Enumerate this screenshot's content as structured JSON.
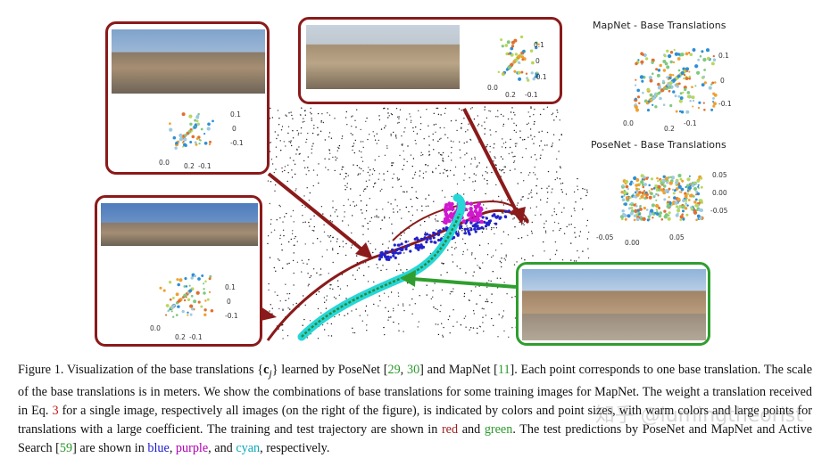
{
  "plots": {
    "mapnet_title": "MapNet - Base Translations",
    "posenet_title": "PoseNet - Base Translations",
    "mapnet_ticks_z": [
      "0.1",
      "0",
      "-0.1"
    ],
    "mapnet_ticks_x": [
      "0.0",
      "0.2",
      "-0.1"
    ],
    "posenet_ticks_z": [
      "0.05",
      "0.00",
      "-0.05"
    ],
    "posenet_ticks_x": [
      "-0.05",
      "0.00",
      "0.05"
    ],
    "callout_ticks_z": [
      "0.1",
      "0",
      "-0.1"
    ],
    "callout_ticks_x": [
      "0.0",
      "0.2",
      "-0.1"
    ]
  },
  "caption": {
    "label": "Figure 1.",
    "text_1": " Visualization of the base translations {",
    "math_c": "c",
    "math_j": "j",
    "text_2": "} learned by PoseNet [",
    "ref_29": "29",
    "comma": ", ",
    "ref_30": "30",
    "text_3": "] and MapNet [",
    "ref_11": "11",
    "text_4": "]. Each point corresponds to one base translation. The scale of the base translations is in meters. We show the combinations of base translations for some training images for MapNet. The weight a translation received in Eq. ",
    "eq_3": "3",
    "text_5": " for a single image, respectively all images (on the right of the figure), is indicated by colors and point sizes, with warm colors and large points for translations with a large coefficient. The training and test trajectory are shown in ",
    "word_red": "red",
    "text_and": " and ",
    "word_green": "green",
    "text_6": ". The test predictions by PoseNet and MapNet and Active Search [",
    "ref_59": "59",
    "text_7": "] are shown in ",
    "word_blue": "blue",
    "text_8": ", ",
    "word_purple": "purple",
    "text_9": ", and ",
    "word_cyan": "cyan",
    "text_10": ", respectively."
  },
  "watermark": "知乎 @lumingtheorist",
  "colors": {
    "train_arrow": "#8b1a1a",
    "test_arrow": "#2f9e2f",
    "posenet_pred": "#1a1acc",
    "mapnet_pred": "#b000b0",
    "active_search_pred": "#0aa8b8"
  }
}
